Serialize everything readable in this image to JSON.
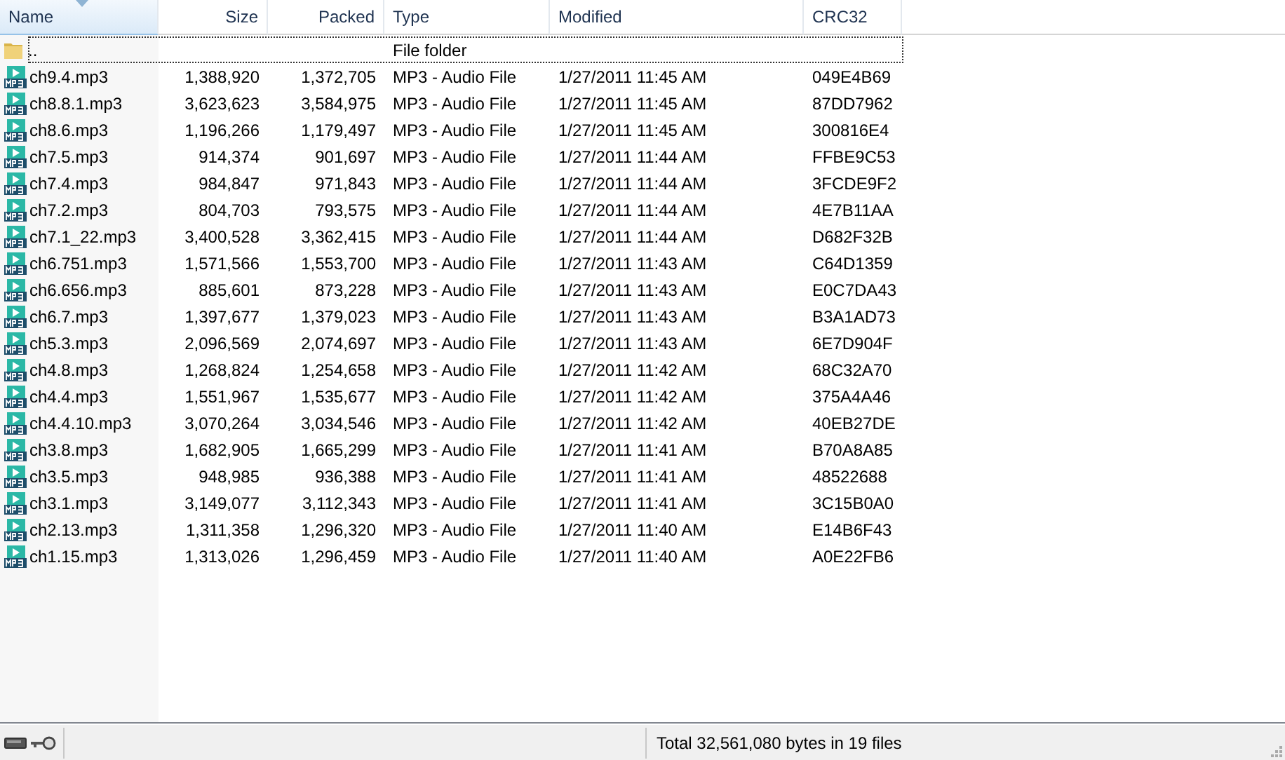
{
  "table": {
    "columns": [
      {
        "label": "Name",
        "sorted": true
      },
      {
        "label": "Size",
        "sorted": false
      },
      {
        "label": "Packed",
        "sorted": false
      },
      {
        "label": "Type",
        "sorted": false
      },
      {
        "label": "Modified",
        "sorted": false
      },
      {
        "label": "CRC32",
        "sorted": false
      }
    ],
    "rows": [
      {
        "kind": "folder",
        "focused": true,
        "cells": [
          "..",
          "",
          "",
          "File folder",
          "",
          ""
        ]
      },
      {
        "kind": "mp3",
        "focused": false,
        "cells": [
          "ch9.4.mp3",
          "1,388,920",
          "1,372,705",
          "MP3 - Audio File",
          "1/27/2011 11:45 AM",
          "049E4B69"
        ]
      },
      {
        "kind": "mp3",
        "focused": false,
        "cells": [
          "ch8.8.1.mp3",
          "3,623,623",
          "3,584,975",
          "MP3 - Audio File",
          "1/27/2011 11:45 AM",
          "87DD7962"
        ]
      },
      {
        "kind": "mp3",
        "focused": false,
        "cells": [
          "ch8.6.mp3",
          "1,196,266",
          "1,179,497",
          "MP3 - Audio File",
          "1/27/2011 11:45 AM",
          "300816E4"
        ]
      },
      {
        "kind": "mp3",
        "focused": false,
        "cells": [
          "ch7.5.mp3",
          "914,374",
          "901,697",
          "MP3 - Audio File",
          "1/27/2011 11:44 AM",
          "FFBE9C53"
        ]
      },
      {
        "kind": "mp3",
        "focused": false,
        "cells": [
          "ch7.4.mp3",
          "984,847",
          "971,843",
          "MP3 - Audio File",
          "1/27/2011 11:44 AM",
          "3FCDE9F2"
        ]
      },
      {
        "kind": "mp3",
        "focused": false,
        "cells": [
          "ch7.2.mp3",
          "804,703",
          "793,575",
          "MP3 - Audio File",
          "1/27/2011 11:44 AM",
          "4E7B11AA"
        ]
      },
      {
        "kind": "mp3",
        "focused": false,
        "cells": [
          "ch7.1_22.mp3",
          "3,400,528",
          "3,362,415",
          "MP3 - Audio File",
          "1/27/2011 11:44 AM",
          "D682F32B"
        ]
      },
      {
        "kind": "mp3",
        "focused": false,
        "cells": [
          "ch6.751.mp3",
          "1,571,566",
          "1,553,700",
          "MP3 - Audio File",
          "1/27/2011 11:43 AM",
          "C64D1359"
        ]
      },
      {
        "kind": "mp3",
        "focused": false,
        "cells": [
          "ch6.656.mp3",
          "885,601",
          "873,228",
          "MP3 - Audio File",
          "1/27/2011 11:43 AM",
          "E0C7DA43"
        ]
      },
      {
        "kind": "mp3",
        "focused": false,
        "cells": [
          "ch6.7.mp3",
          "1,397,677",
          "1,379,023",
          "MP3 - Audio File",
          "1/27/2011 11:43 AM",
          "B3A1AD73"
        ]
      },
      {
        "kind": "mp3",
        "focused": false,
        "cells": [
          "ch5.3.mp3",
          "2,096,569",
          "2,074,697",
          "MP3 - Audio File",
          "1/27/2011 11:43 AM",
          "6E7D904F"
        ]
      },
      {
        "kind": "mp3",
        "focused": false,
        "cells": [
          "ch4.8.mp3",
          "1,268,824",
          "1,254,658",
          "MP3 - Audio File",
          "1/27/2011 11:42 AM",
          "68C32A70"
        ]
      },
      {
        "kind": "mp3",
        "focused": false,
        "cells": [
          "ch4.4.mp3",
          "1,551,967",
          "1,535,677",
          "MP3 - Audio File",
          "1/27/2011 11:42 AM",
          "375A4A46"
        ]
      },
      {
        "kind": "mp3",
        "focused": false,
        "cells": [
          "ch4.4.10.mp3",
          "3,070,264",
          "3,034,546",
          "MP3 - Audio File",
          "1/27/2011 11:42 AM",
          "40EB27DE"
        ]
      },
      {
        "kind": "mp3",
        "focused": false,
        "cells": [
          "ch3.8.mp3",
          "1,682,905",
          "1,665,299",
          "MP3 - Audio File",
          "1/27/2011 11:41 AM",
          "B70A8A85"
        ]
      },
      {
        "kind": "mp3",
        "focused": false,
        "cells": [
          "ch3.5.mp3",
          "948,985",
          "936,388",
          "MP3 - Audio File",
          "1/27/2011 11:41 AM",
          "48522688"
        ]
      },
      {
        "kind": "mp3",
        "focused": false,
        "cells": [
          "ch3.1.mp3",
          "3,149,077",
          "3,112,343",
          "MP3 - Audio File",
          "1/27/2011 11:41 AM",
          "3C15B0A0"
        ]
      },
      {
        "kind": "mp3",
        "focused": false,
        "cells": [
          "ch2.13.mp3",
          "1,311,358",
          "1,296,320",
          "MP3 - Audio File",
          "1/27/2011 11:40 AM",
          "E14B6F43"
        ]
      },
      {
        "kind": "mp3",
        "focused": false,
        "cells": [
          "ch1.15.mp3",
          "1,313,026",
          "1,296,459",
          "MP3 - Audio File",
          "1/27/2011 11:40 AM",
          "A0E22FB6"
        ]
      }
    ]
  },
  "status_bar": {
    "text": "Total 32,561,080 bytes in 19 files"
  }
}
